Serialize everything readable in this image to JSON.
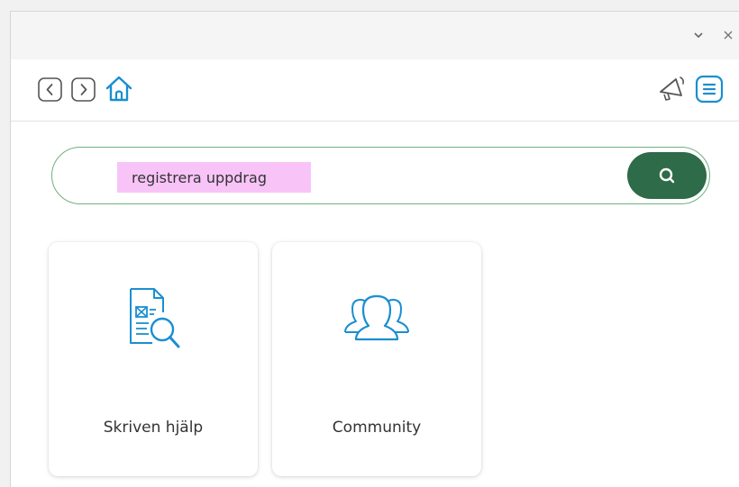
{
  "window_controls": {
    "minimize_icon": "chevron-down-icon",
    "close_icon": "close-icon"
  },
  "toolbar": {
    "back_icon": "chevron-left-icon",
    "forward_icon": "chevron-right-icon",
    "home_icon": "home-icon",
    "announcements_icon": "megaphone-icon",
    "menu_icon": "menu-icon"
  },
  "search": {
    "value": "registrera uppdrag",
    "button_icon": "search-icon"
  },
  "cards": [
    {
      "label": "Skriven hjälp",
      "icon": "document-search-icon"
    },
    {
      "label": "Community",
      "icon": "people-group-icon"
    }
  ],
  "colors": {
    "accent_green": "#2e6b48",
    "search_border": "#6fb07f",
    "icon_blue": "#1a8fd1",
    "highlight": "#f8c4f8"
  }
}
